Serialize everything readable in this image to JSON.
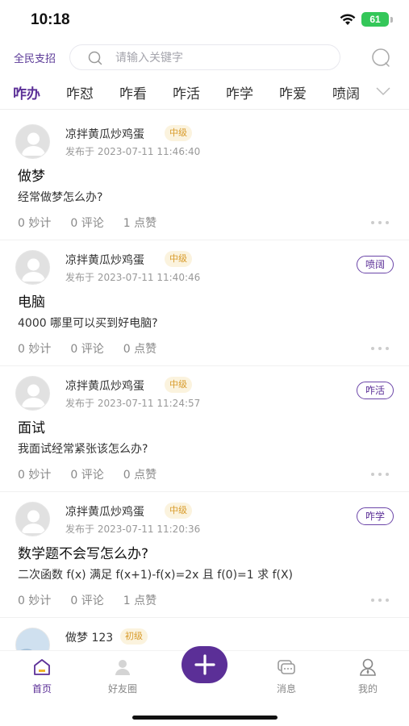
{
  "status_bar": {
    "time": "10:18",
    "battery": "61"
  },
  "header": {
    "brand": "全民支招",
    "search_placeholder": "请输入关键字"
  },
  "tabs": [
    {
      "label": "咋办",
      "active": true
    },
    {
      "label": "咋怼"
    },
    {
      "label": "咋看"
    },
    {
      "label": "咋活"
    },
    {
      "label": "咋学"
    },
    {
      "label": "咋爱"
    },
    {
      "label": "喷阔"
    }
  ],
  "posts": [
    {
      "author": "凉拌黄瓜炒鸡蛋",
      "level": "中级",
      "time": "发布于 2023-07-11 11:46:40",
      "category": "",
      "title": "做梦",
      "body": "经常做梦怎么办?",
      "tips": "0 妙计",
      "comments": "0 评论",
      "likes": "1 点赞"
    },
    {
      "author": "凉拌黄瓜炒鸡蛋",
      "level": "中级",
      "time": "发布于 2023-07-11 11:40:46",
      "category": "喷阔",
      "title": "电脑",
      "body": "4000 哪里可以买到好电脑?",
      "tips": "0 妙计",
      "comments": "0 评论",
      "likes": "0 点赞"
    },
    {
      "author": "凉拌黄瓜炒鸡蛋",
      "level": "中级",
      "time": "发布于 2023-07-11 11:24:57",
      "category": "咋活",
      "title": "面试",
      "body": "我面试经常紧张该怎么办?",
      "tips": "0 妙计",
      "comments": "0 评论",
      "likes": "0 点赞"
    },
    {
      "author": "凉拌黄瓜炒鸡蛋",
      "level": "中级",
      "time": "发布于 2023-07-11 11:20:36",
      "category": "咋学",
      "title": "数学题不会写怎么办?",
      "body": "二次函数 f(x) 满足 f(x+1)-f(x)=2x 且 f(0)=1 求 f(X)",
      "tips": "0 妙计",
      "comments": "0 评论",
      "likes": "1 点赞"
    },
    {
      "author": "做梦 123",
      "level": "初级"
    }
  ],
  "tab_bar": {
    "home": "首页",
    "friends": "好友圈",
    "messages": "消息",
    "mine": "我的"
  },
  "colors": {
    "accent": "#5b2f97",
    "level_bg": "#fbf3de",
    "level_text": "#d89b2b"
  }
}
